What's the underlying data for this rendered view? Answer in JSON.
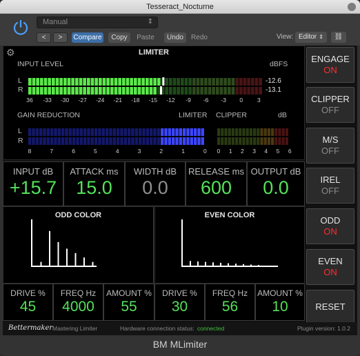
{
  "window": {
    "title": "Tesseract_Nocturne",
    "footer_name": "BM MLimiter"
  },
  "host": {
    "preset": "Manual",
    "compare": "Compare",
    "copy": "Copy",
    "paste": "Paste",
    "undo": "Undo",
    "redo": "Redo",
    "view_label": "View:",
    "view_value": "Editor",
    "prev": "<",
    "next": ">"
  },
  "limiter": {
    "title": "LIMITER",
    "input_level_label": "INPUT LEVEL",
    "dbfs_label": "dBFS",
    "channel_l": "L",
    "channel_r": "R",
    "value_l": "-12.6",
    "value_r": "-13.1",
    "input_ticks": [
      "36",
      "-33",
      "-30",
      "-27",
      "-24",
      "-21",
      "-18",
      "-15",
      "-12",
      "-9",
      "-6",
      "-3",
      "0",
      "3"
    ],
    "input_level_l": 0.56,
    "input_level_r": 0.55,
    "gain_reduction_label": "GAIN REDUCTION",
    "limiter_label": "LIMITER",
    "clipper_label": "CLIPPER",
    "db_label": "dB",
    "gr_ticks": [
      "8",
      "7",
      "6",
      "5",
      "4",
      "3",
      "2",
      "1",
      "0"
    ],
    "gr_value": 2,
    "clip_ticks": [
      "0",
      "1",
      "2",
      "3",
      "4",
      "5",
      "6"
    ]
  },
  "side_buttons": [
    {
      "name": "ENGAGE",
      "state": "ON"
    },
    {
      "name": "CLIPPER",
      "state": "OFF"
    },
    {
      "name": "M/S",
      "state": "OFF"
    },
    {
      "name": "IREL",
      "state": "OFF"
    },
    {
      "name": "ODD",
      "state": "ON"
    },
    {
      "name": "EVEN",
      "state": "ON"
    },
    {
      "name": "RESET",
      "state": ""
    }
  ],
  "params": [
    {
      "label": "INPUT dB",
      "value": "+15.7"
    },
    {
      "label": "ATTACK ms",
      "value": "15.0"
    },
    {
      "label": "WIDTH dB",
      "value": "0.0"
    },
    {
      "label": "RELEASE ms",
      "value": "600"
    },
    {
      "label": "OUTPUT dB",
      "value": "0.0"
    }
  ],
  "odd": {
    "title": "ODD COLOR",
    "harmonics": [
      1.0,
      0.1,
      0.8,
      0.55,
      0.4,
      0.3,
      0.2,
      0.1
    ],
    "drive_label": "DRIVE %",
    "drive": "45",
    "freq_label": "FREQ Hz",
    "freq": "4000",
    "amount_label": "AMOUNT %",
    "amount": "55"
  },
  "even": {
    "title": "EVEN COLOR",
    "harmonics": [
      1.0,
      0.12,
      0.11,
      0.1,
      0.09,
      0.08,
      0.07,
      0.06,
      0.05,
      0.04,
      0.03
    ],
    "drive_label": "DRIVE %",
    "drive": "30",
    "freq_label": "FREQ Hz",
    "freq": "56",
    "amount_label": "AMOUNT %",
    "amount": "10"
  },
  "footer": {
    "brand": "Bettermaker",
    "product": "Mastering Limiter",
    "hw_label": "Hardware connection status:",
    "hw_status": "connected",
    "version": "Plugin version: 1.0.2"
  },
  "colors": {
    "on": "#ff2e2e",
    "off": "#8a8a8a",
    "value_green": "#55e25a",
    "value_grey": "#8f8f8f",
    "connected": "#3fbf3f"
  }
}
